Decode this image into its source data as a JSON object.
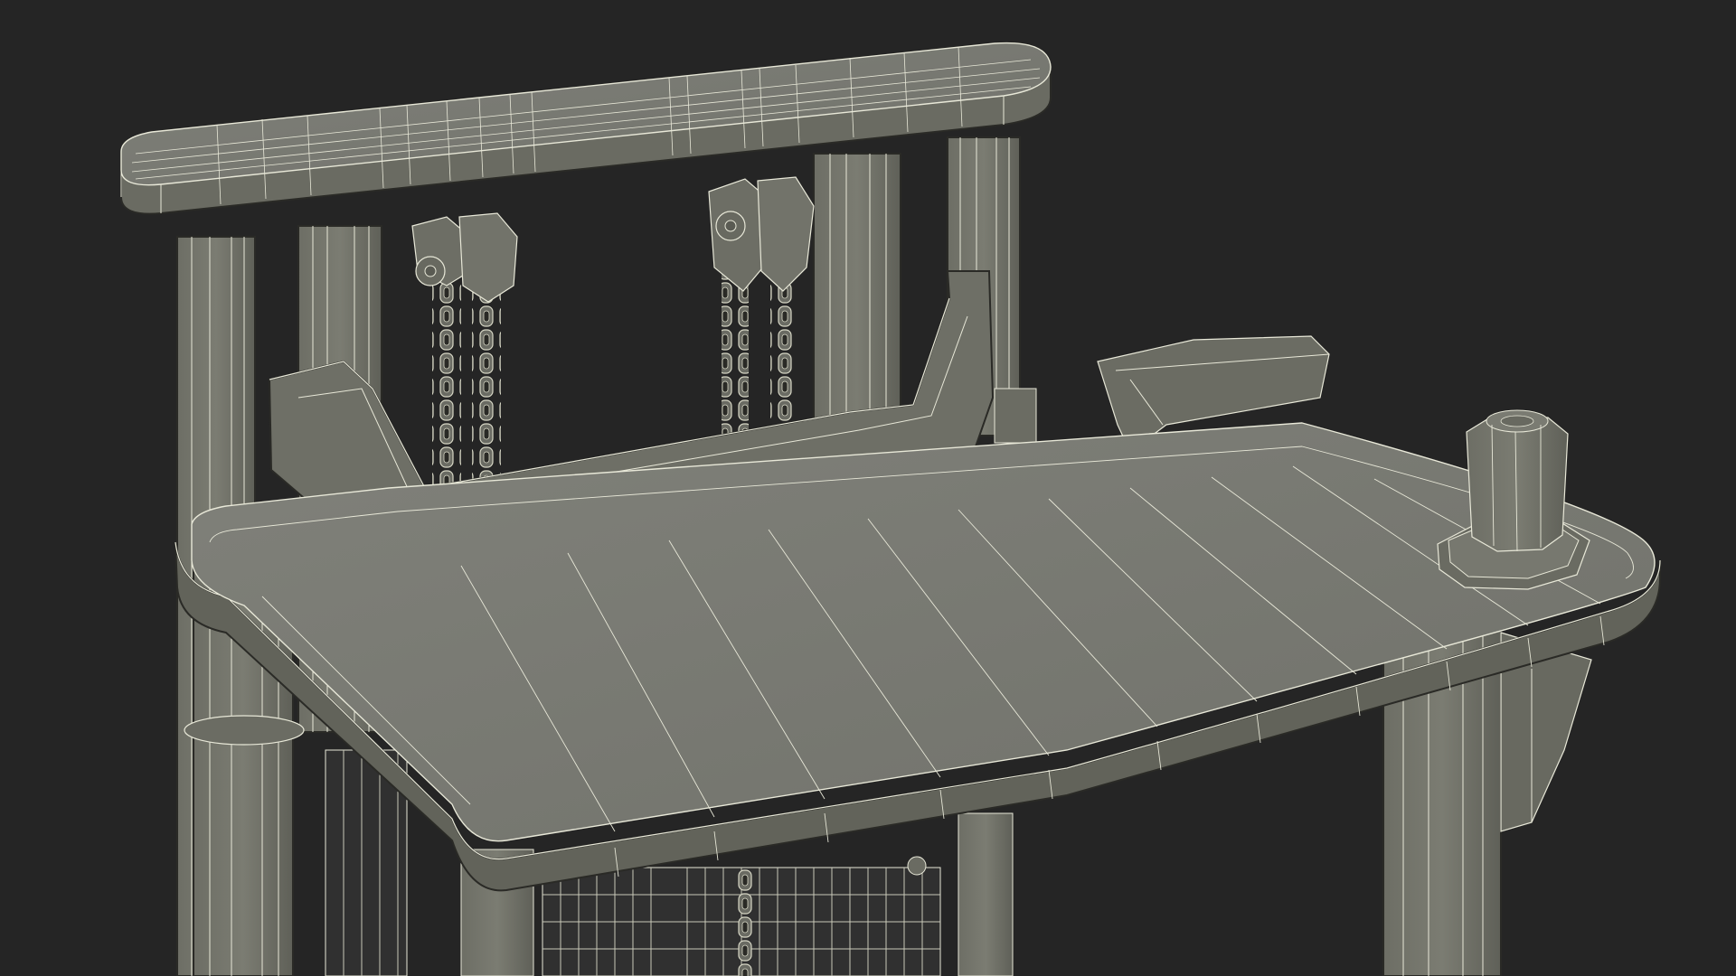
{
  "scene": {
    "subject": "wireframe-render",
    "colors": {
      "background": "#252525",
      "surface": "#74756a",
      "surface_light": "#80817a",
      "surface_dark": "#5e5f55",
      "wire": "#e8e8d8",
      "wire_dim": "#c9c9b8",
      "outline": "#2a2a26"
    }
  }
}
